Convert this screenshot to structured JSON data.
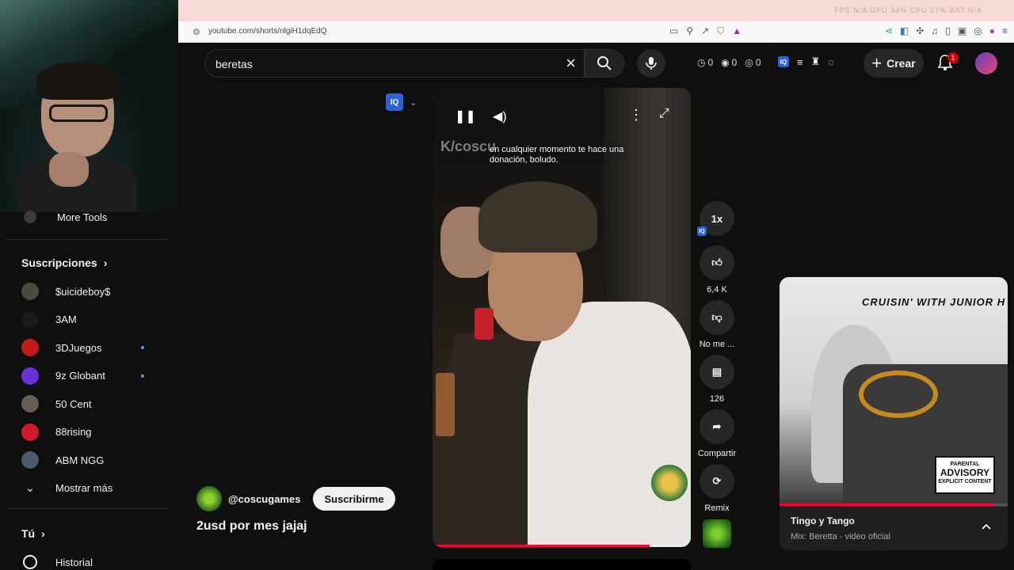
{
  "browser": {
    "url": "youtube.com/shorts/nlgiH1dqEdQ",
    "overlay_stats": "FPS N/A   GPU 34%   CPU 27%   BAT N/A"
  },
  "search": {
    "query": "beretas"
  },
  "header": {
    "counters": [
      "0",
      "0",
      "0"
    ],
    "create_label": "Crear",
    "notification_count": "1"
  },
  "sidebar": {
    "more_tools_label": "More Tools",
    "subscriptions_heading": "Suscripciones",
    "subscriptions": [
      {
        "label": "$uicideboy$",
        "color": "#4a4a3a",
        "new": false
      },
      {
        "label": "3AM",
        "color": "#1a1a1a",
        "new": false
      },
      {
        "label": "3DJuegos",
        "color": "#c41a1a",
        "new": true
      },
      {
        "label": "9z Globant",
        "color": "#6b2fd6",
        "new": true
      },
      {
        "label": "50 Cent",
        "color": "#6a5c50",
        "new": false
      },
      {
        "label": "88rising",
        "color": "#d11a2a",
        "new": false
      },
      {
        "label": "ABM NGG",
        "color": "#4a5a6a",
        "new": false
      }
    ],
    "show_more_label": "Mostrar más",
    "you_heading": "Tú",
    "history_label": "Historial"
  },
  "player": {
    "watermark": "K/coscu",
    "caption": "en cualquier momento te hace una donación, boludo.",
    "progress": 0.84
  },
  "actions": {
    "speed_label": "1x",
    "likes": "6,4 K",
    "dislike_label": "No me ...",
    "comments": "126",
    "share_label": "Compartir",
    "remix_label": "Remix"
  },
  "channel": {
    "handle": "@coscugames",
    "subscribe_label": "Suscribirme",
    "short_title": "2usd por mes jajaj"
  },
  "mini_player": {
    "art_title": "CRUISIN' WITH JUNIOR H",
    "advisory_top": "PARENTAL",
    "advisory_mid": "ADVISORY",
    "advisory_bottom": "EXPLICIT CONTENT",
    "title": "Tingo y Tango",
    "subtitle": "Mix: Beretta - video oficial",
    "progress": 0.94
  },
  "colors": {
    "accent_red": "#ff0033",
    "background": "#0f0f0f",
    "iq_blue": "#2b63d9"
  }
}
